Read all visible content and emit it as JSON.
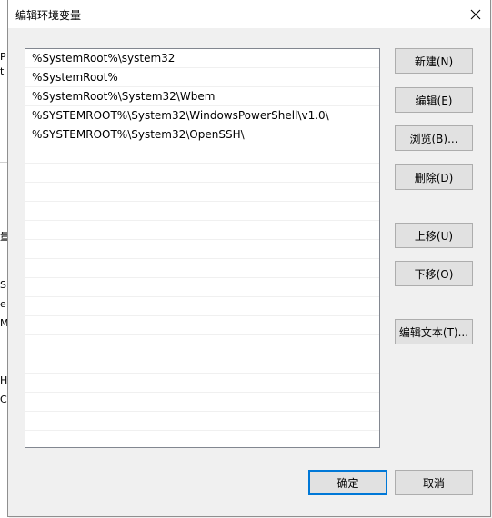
{
  "dialog": {
    "title": "编辑环境变量",
    "close_icon": "close-icon"
  },
  "paths": [
    "%SystemRoot%\\system32",
    "%SystemRoot%",
    "%SystemRoot%\\System32\\Wbem",
    "%SYSTEMROOT%\\System32\\WindowsPowerShell\\v1.0\\",
    "%SYSTEMROOT%\\System32\\OpenSSH\\"
  ],
  "buttons": {
    "new": "新建(N)",
    "edit": "编辑(E)",
    "browse": "浏览(B)...",
    "delete": "删除(D)",
    "move_up": "上移(U)",
    "move_down": "下移(O)",
    "edit_text": "编辑文本(T)...",
    "ok": "确定",
    "cancel": "取消"
  },
  "background_fragments": [
    "P",
    "t",
    "量",
    "S",
    "e",
    "M",
    "H",
    "C"
  ]
}
